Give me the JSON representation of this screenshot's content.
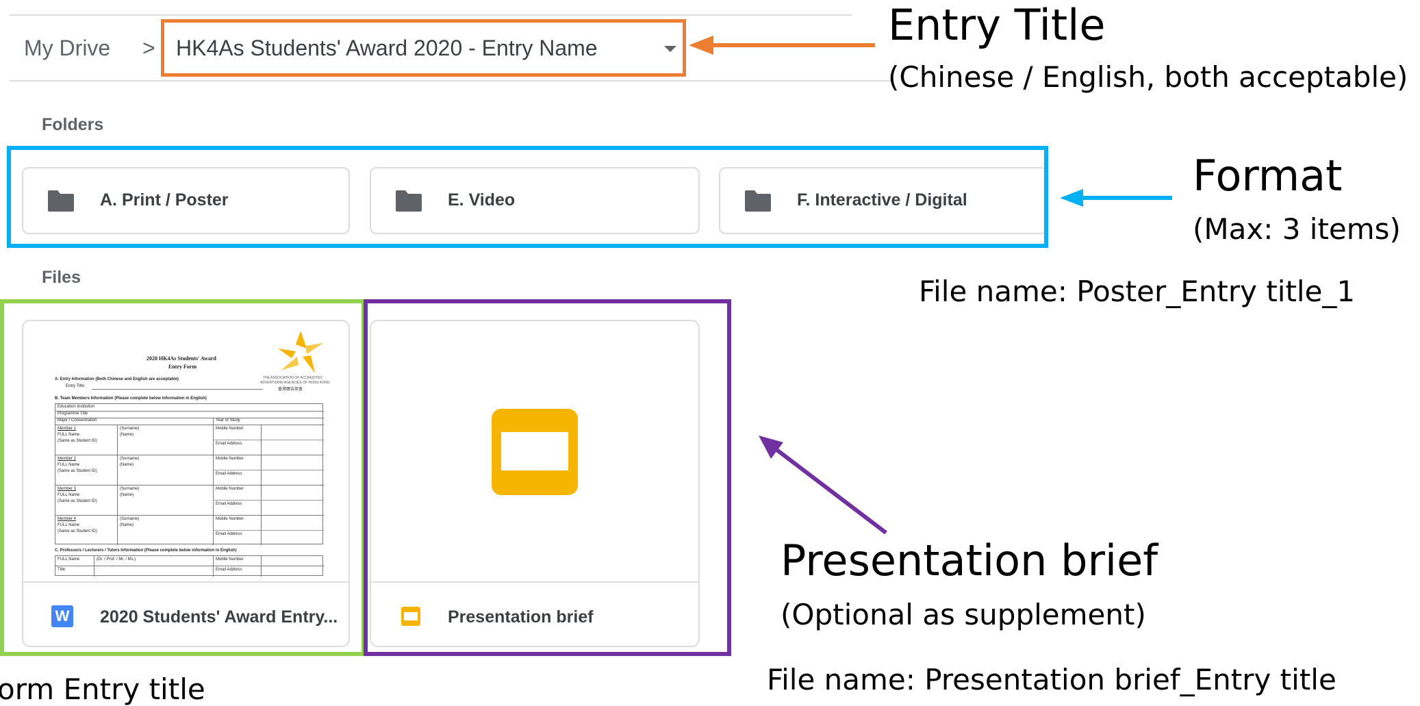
{
  "breadcrumb": {
    "root": "My Drive",
    "separator": ">",
    "current": "HK4As Students' Award 2020 - Entry Name"
  },
  "sections": {
    "folders": "Folders",
    "files": "Files"
  },
  "folders": [
    {
      "label": "A. Print / Poster"
    },
    {
      "label": "E. Video"
    },
    {
      "label": "F. Interactive / Digital"
    }
  ],
  "files": [
    {
      "name": "2020 Students' Award Entry...",
      "type_badge": "W"
    },
    {
      "name": "Presentation brief"
    }
  ],
  "doc_preview": {
    "title": "2020 HK4As Students' Award",
    "subtitle": "Entry Form",
    "section_a": "A.  Entry Information (Both Chinese and English are acceptable)",
    "entry_title": "Entry Title:",
    "section_b": "B.  Team Members Information (Please complete below information in English)",
    "section_c": "C.  Professors / Lecturers / Tutors Information (Please complete below information in English)",
    "org_line1": "THE ASSOCIATION OF ACCREDITED",
    "org_line2": "ADVERTISING AGENCIES OF HONG KONG",
    "org_line3": "香港廣告商會",
    "row_education": "Education Institution",
    "row_programme": "Programme Title",
    "row_major": "Major / Concentration",
    "row_year": "Year of Study",
    "member1": "Member 1",
    "member2": "Member 2",
    "member3": "Member 3",
    "member4": "Member 4",
    "full_name": "FULL Name",
    "same_as_id": "(Same as Student ID)",
    "surname": "(Surname)",
    "name": "(Name)",
    "mobile": "Mobile Number",
    "email": "Email Address",
    "prof_full_name": "FULL Name",
    "prof_title": "Title",
    "prof_honorific": "(Dr. / Prof. / Mr. / Ms.)"
  },
  "annotations": {
    "entry_title": "Entry Title",
    "entry_title_note": "(Chinese / English, both acceptable)",
    "format": "Format",
    "format_note": "(Max: 3 items)",
    "poster_filename": "File name: Poster_Entry title_1",
    "presentation": "Presentation brief",
    "presentation_note": "(Optional as supplement)",
    "presentation_filename": "File name: Presentation brief_Entry title",
    "form_filename": "orm  Entry title"
  },
  "colors": {
    "orange": "#ed7d31",
    "blue": "#00b0f0",
    "green": "#92d050",
    "purple": "#7030a0",
    "folder_icon": "#5f6368",
    "slides_yellow": "#f4b400",
    "word_blue": "#4285f4"
  }
}
